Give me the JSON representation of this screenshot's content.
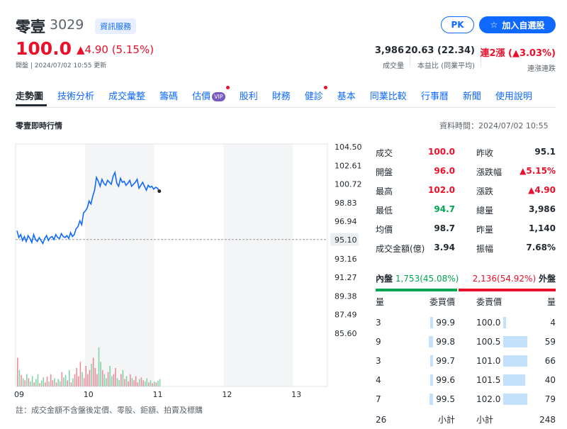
{
  "header": {
    "name": "零壹",
    "code": "3029",
    "badge": "資訊服務",
    "pk": "PK",
    "fav": "加入自選股",
    "price": "100.0",
    "change": "▲4.90 (5.15%)",
    "meta": "開盤 | 2024/07/02 10:55 更新"
  },
  "stats": [
    {
      "value": "3,986",
      "label": "成交量"
    },
    {
      "value": "20.63 (22.34)",
      "label": "本益比 (同業平均)"
    },
    {
      "value": "連2漲 (▲3.03%)",
      "label": "連漲連跌"
    }
  ],
  "tabs": [
    "走勢圖",
    "技術分析",
    "成交彙整",
    "籌碼",
    "估價",
    "股利",
    "財務",
    "健診",
    "基本",
    "同業比較",
    "行事曆",
    "新聞",
    "使用說明"
  ],
  "vip": "VIP",
  "section": {
    "title": "零壹即時行情",
    "time": "資料時間：2024/07/02 10:55"
  },
  "quote_left": [
    [
      "成交",
      "100.0"
    ],
    [
      "開盤",
      "96.0"
    ],
    [
      "最高",
      "102.0"
    ],
    [
      "最低",
      "94.7"
    ],
    [
      "均價",
      "98.7"
    ],
    [
      "成交金額(億)",
      "3.94"
    ]
  ],
  "quote_right": [
    [
      "昨收",
      "95.1"
    ],
    [
      "漲跌幅",
      "▲5.15%"
    ],
    [
      "漲跌",
      "▲4.90"
    ],
    [
      "總量",
      "3,986"
    ],
    [
      "昨量",
      "1,140"
    ],
    [
      "振幅",
      "7.68%"
    ]
  ],
  "inout": {
    "in_label": "內盤",
    "in_val": "1,753(45.08%)",
    "out_val": "2,136(54.92%)",
    "out_label": "外盤",
    "in_frac": 0.4508
  },
  "orderbook": {
    "headers": [
      "量",
      "委買價",
      "委賣價",
      "量"
    ],
    "rows": [
      {
        "bq": "3",
        "bp": "99.9",
        "ap": "100.0",
        "aq": "4",
        "bf": 0.05,
        "af": 0.05
      },
      {
        "bq": "9",
        "bp": "99.8",
        "ap": "100.5",
        "aq": "59",
        "bf": 0.11,
        "af": 0.75
      },
      {
        "bq": "3",
        "bp": "99.7",
        "ap": "101.0",
        "aq": "66",
        "bf": 0.05,
        "af": 0.84
      },
      {
        "bq": "4",
        "bp": "99.6",
        "ap": "101.5",
        "aq": "40",
        "bf": 0.06,
        "af": 0.51
      },
      {
        "bq": "7",
        "bp": "99.5",
        "ap": "102.0",
        "aq": "79",
        "bf": 0.09,
        "af": 1.0
      }
    ],
    "total": [
      "26",
      "小計",
      "小計",
      "248"
    ]
  },
  "footnote": "註：成交金額不含盤後定價、零股、鉅額、拍賣及標購",
  "chart_data": {
    "type": "line",
    "x_ticks": [
      "09",
      "10",
      "11",
      "12",
      "13"
    ],
    "y_ticks": [
      "104.50",
      "102.61",
      "100.72",
      "98.83",
      "96.94",
      "95.10",
      "93.16",
      "91.27",
      "89.38",
      "87.49",
      "85.60"
    ],
    "prev_close": 95.1,
    "ylim": [
      85.6,
      104.5
    ],
    "price": [
      96.0,
      95.3,
      95.6,
      95.0,
      95.4,
      94.9,
      95.5,
      95.2,
      94.8,
      95.6,
      95.1,
      94.9,
      95.3,
      95.0,
      94.7,
      95.2,
      95.5,
      95.0,
      95.3,
      95.4,
      95.1,
      95.6,
      95.3,
      95.2,
      95.7,
      95.4,
      95.3,
      95.5,
      95.2,
      95.8,
      95.4,
      95.6,
      96.2,
      96.4,
      97.0,
      96.6,
      97.8,
      98.0,
      98.3,
      99.0,
      98.7,
      99.5,
      100.1,
      101.4,
      101.0,
      100.5,
      101.2,
      100.8,
      100.6,
      101.1,
      100.9,
      100.7,
      101.5,
      101.9,
      100.8,
      100.5,
      101.3,
      100.9,
      101.0,
      100.6,
      100.8,
      101.1,
      100.5,
      100.7,
      100.9,
      101.2,
      100.3,
      100.6,
      100.9,
      100.5,
      100.1,
      100.6,
      100.4,
      100.5,
      100.2,
      100.4,
      100.3,
      100.0
    ],
    "volume": [
      70,
      40,
      28,
      20,
      15,
      30,
      20,
      12,
      25,
      10,
      18,
      30,
      8,
      14,
      22,
      10,
      24,
      12,
      30,
      15,
      20,
      10,
      18,
      12,
      35,
      22,
      28,
      15,
      40,
      10,
      20,
      30,
      45,
      25,
      60,
      35,
      20,
      50,
      30,
      40,
      55,
      70,
      45,
      30,
      95,
      60,
      40,
      30,
      20,
      35,
      50,
      25,
      30,
      45,
      20,
      15,
      30,
      40,
      18,
      25,
      12,
      30,
      20,
      15,
      25,
      10,
      18,
      22,
      15,
      12,
      20,
      10,
      15,
      8,
      12,
      10,
      14,
      18
    ],
    "x_minutes": 275
  },
  "colors": {
    "up": "#eb0f29",
    "down": "#00a64f",
    "line": "#0f69ff",
    "link": "#0f69ff"
  }
}
